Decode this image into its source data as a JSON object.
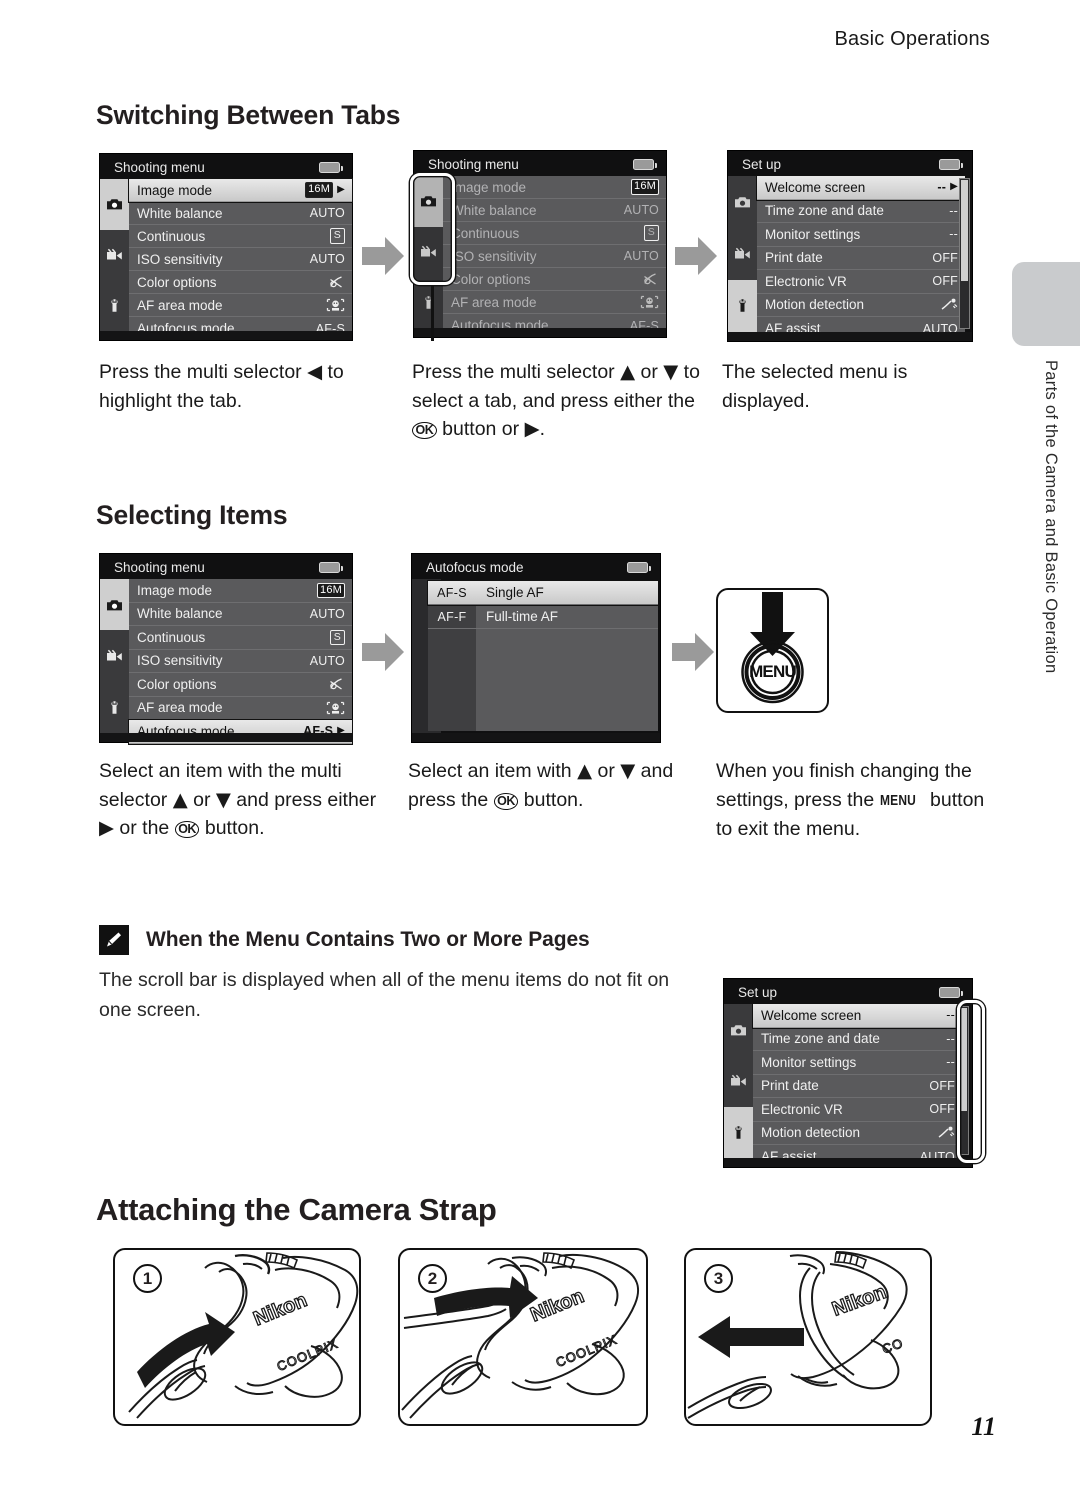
{
  "page": {
    "running_head": "Basic Operations",
    "number": "11",
    "side_tab_label": "Parts of the Camera and Basic Operation"
  },
  "sections": {
    "switching_tabs": {
      "heading": "Switching Between Tabs",
      "captions": [
        "Press the multi selector ◀ to highlight the tab.",
        "Press the multi selector ▲ or ▼ to select a tab, and press either the ⒪ button or ▶.",
        "The selected menu is displayed."
      ]
    },
    "selecting_items": {
      "heading": "Selecting Items",
      "captions": [
        "Select an item with the multi selector ▲ or ▼ and press either ▶ or the ⒪ button.",
        "Select an item with ▲ or ▼ and press the ⒪ button.",
        "When you finish changing the settings, press the MENU button to exit the menu."
      ]
    },
    "note": {
      "icon": "pencil-icon",
      "title": "When the Menu Contains Two or More Pages",
      "body": "The scroll bar is displayed when all of the menu items do not fit on one screen."
    },
    "strap": {
      "heading": "Attaching the Camera Strap",
      "steps": [
        "1",
        "2",
        "3"
      ],
      "camera_brand": "Nikon",
      "camera_model": "COOLPIX"
    }
  },
  "screens": {
    "shooting_menu": {
      "title": "Shooting menu",
      "tabs": [
        "camera-tab-icon",
        "movie-tab-icon",
        "setup-tab-icon"
      ],
      "selected_tab": 0,
      "items": [
        {
          "label": "Image mode",
          "value": "16M",
          "value_kind": "imgmode"
        },
        {
          "label": "White balance",
          "value": "AUTO",
          "value_kind": "text"
        },
        {
          "label": "Continuous",
          "value": "S",
          "value_kind": "boxed"
        },
        {
          "label": "ISO sensitivity",
          "value": "AUTO",
          "value_kind": "text"
        },
        {
          "label": "Color options",
          "value": "color-off-icon",
          "value_kind": "icon"
        },
        {
          "label": "AF area mode",
          "value": "face-priority-icon",
          "value_kind": "icon"
        },
        {
          "label": "Autofocus mode",
          "value": "AF-S",
          "value_kind": "text"
        }
      ],
      "selected_row_first": 0,
      "selected_row_items": 6
    },
    "setup_menu": {
      "title": "Set up",
      "tabs": [
        "camera-tab-icon",
        "movie-tab-icon",
        "setup-tab-icon"
      ],
      "selected_tab": 2,
      "items": [
        {
          "label": "Welcome screen",
          "value": "--",
          "value_kind": "text"
        },
        {
          "label": "Time zone and date",
          "value": "--",
          "value_kind": "text"
        },
        {
          "label": "Monitor settings",
          "value": "--",
          "value_kind": "text"
        },
        {
          "label": "Print date",
          "value": "OFF",
          "value_kind": "text"
        },
        {
          "label": "Electronic VR",
          "value": "OFF",
          "value_kind": "text"
        },
        {
          "label": "Motion detection",
          "value": "motion-detect-icon",
          "value_kind": "icon"
        },
        {
          "label": "AF assist",
          "value": "AUTO",
          "value_kind": "text"
        }
      ],
      "selected_row": 0
    },
    "autofocus_mode": {
      "title": "Autofocus mode",
      "options": [
        {
          "code": "AF-S",
          "label": "Single AF"
        },
        {
          "code": "AF-F",
          "label": "Full-time AF"
        }
      ],
      "selected_option": 0
    },
    "menu_button": {
      "label": "MENU"
    }
  }
}
